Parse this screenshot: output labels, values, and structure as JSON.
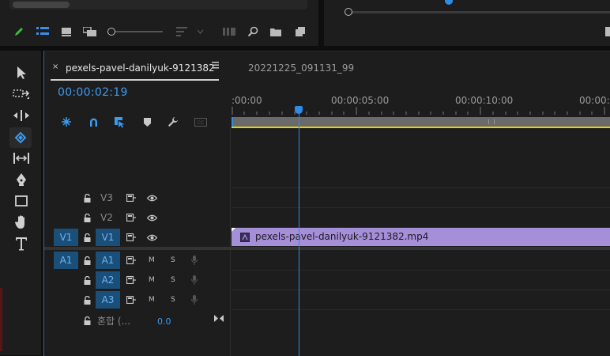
{
  "sequence_tabs": [
    {
      "label": "pexels-pavel-danilyuk-9121382",
      "active": true
    },
    {
      "label": "20221225_091131_99",
      "active": false
    }
  ],
  "timecode": "00:00:02:19",
  "ruler_labels": [
    ":00:00",
    "00:00:05:00",
    "00:00:10:00",
    "00:00:1"
  ],
  "video_tracks": [
    {
      "name": "V3",
      "source": ""
    },
    {
      "name": "V2",
      "source": ""
    },
    {
      "name": "V1",
      "source": "V1"
    }
  ],
  "audio_tracks": [
    {
      "name": "A1",
      "source": "A1",
      "m": "M",
      "s": "S"
    },
    {
      "name": "A2",
      "source": "",
      "m": "M",
      "s": "S"
    },
    {
      "name": "A3",
      "source": "",
      "m": "M",
      "s": "S"
    }
  ],
  "mix_track": {
    "label": "혼합 (...",
    "value": "0.0"
  },
  "clip": {
    "label": "pexels-pavel-danilyuk-9121382.mp4",
    "color": "#a68fd9"
  },
  "colors": {
    "accent": "#2e8ce6",
    "timecode": "#3b9bf0",
    "work_area": "#e8d200"
  },
  "icons": [
    "selection-tool-icon",
    "track-select-forward-icon",
    "ripple-edit-icon",
    "razor-tool-icon",
    "slip-tool-icon",
    "pen-tool-icon",
    "rectangle-tool-icon",
    "hand-tool-icon",
    "type-tool-icon"
  ]
}
